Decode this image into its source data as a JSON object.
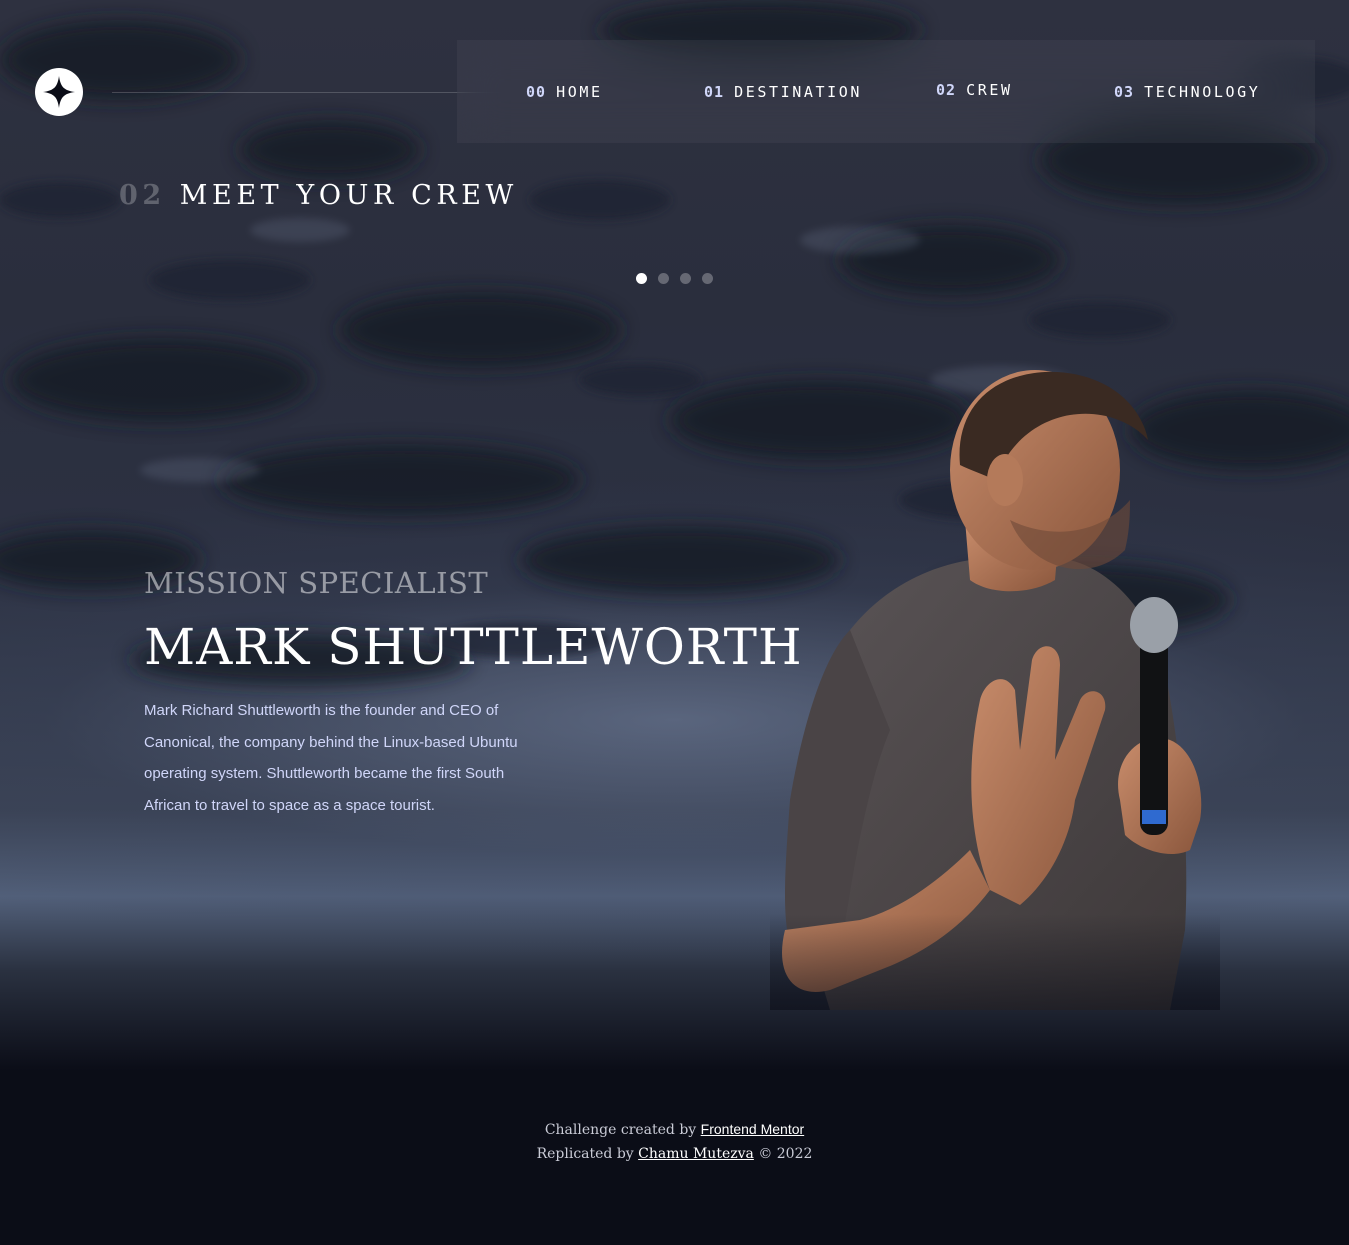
{
  "header": {
    "logo_icon": "star-logo-icon",
    "nav": [
      {
        "num": "00",
        "label": "HOME"
      },
      {
        "num": "01",
        "label": "DESTINATION"
      },
      {
        "num": "02",
        "label": "CREW"
      },
      {
        "num": "03",
        "label": "TECHNOLOGY"
      }
    ]
  },
  "page": {
    "num": "02",
    "title": "MEET YOUR CREW"
  },
  "carousel": {
    "count": 4,
    "active_index": 0
  },
  "crew": {
    "role": "Mission Specialist",
    "name": "Mark Shuttleworth",
    "bio": "Mark Richard Shuttleworth is the founder and CEO of Canonical, the company behind the Linux-based Ubuntu operating system. Shuttleworth became the first South African to travel to space as a space tourist."
  },
  "footer": {
    "line1_prefix": "Challenge created by",
    "line1_link": "Frontend Mentor",
    "line2_prefix": "Replicated by",
    "line2_link": "Chamu Mutezva",
    "line2_suffix": "© 2022"
  },
  "colors": {
    "background": "#0b0d17",
    "accent_text": "#d0d6f9",
    "white": "#ffffff"
  }
}
